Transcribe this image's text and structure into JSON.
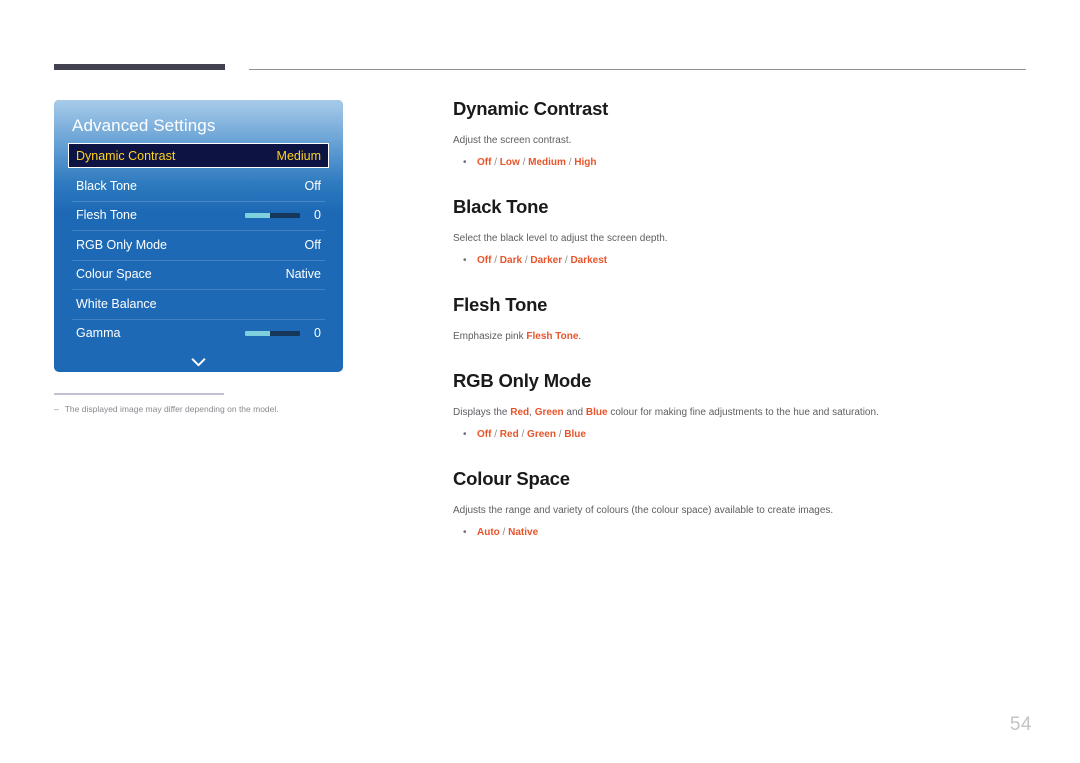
{
  "page_number": "54",
  "osd": {
    "title": "Advanced Settings",
    "rows": [
      {
        "label": "Dynamic Contrast",
        "value": "Medium",
        "type": "value",
        "selected": true
      },
      {
        "label": "Black Tone",
        "value": "Off",
        "type": "value",
        "selected": false
      },
      {
        "label": "Flesh Tone",
        "value": "0",
        "type": "slider",
        "selected": false
      },
      {
        "label": "RGB Only Mode",
        "value": "Off",
        "type": "value",
        "selected": false
      },
      {
        "label": "Colour Space",
        "value": "Native",
        "type": "value",
        "selected": false
      },
      {
        "label": "White Balance",
        "value": "",
        "type": "none",
        "selected": false
      },
      {
        "label": "Gamma",
        "value": "0",
        "type": "slider",
        "selected": false
      }
    ],
    "more_icon": "chevron-down-icon",
    "colors": {
      "panel_blue": "#1d69b5",
      "selected_bg": "#0d1444",
      "selected_text": "#ffd21e",
      "slider_fill": "#7fd0dd",
      "slider_track": "#17365c"
    }
  },
  "note": {
    "dash": "‒",
    "text": "The displayed image may differ depending on the model."
  },
  "doc": {
    "sections": [
      {
        "heading": "Dynamic Contrast",
        "desc_before": "Adjust the screen contrast.",
        "bullet": "•",
        "options": "Off / Low / Medium / High"
      },
      {
        "heading": "Black Tone",
        "desc_before": "Select the black level to adjust the screen depth.",
        "bullet": "•",
        "options": "Off / Dark / Darker / Darkest"
      },
      {
        "heading": "Flesh Tone",
        "desc_before": "Emphasize pink ",
        "desc_em": "Flesh Tone",
        "desc_after": ".",
        "options": ""
      },
      {
        "heading": "RGB Only Mode",
        "desc_before": "Displays the ",
        "desc_em1": "Red",
        "desc_mid1": ", ",
        "desc_em2": "Green",
        "desc_mid2": " and ",
        "desc_em3": "Blue",
        "desc_after": " colour for making fine adjustments to the hue and saturation.",
        "bullet": "•",
        "options": "Off / Red / Green / Blue"
      },
      {
        "heading": "Colour Space",
        "desc_before": "Adjusts the range and variety of colours (the colour space) available to create images.",
        "bullet": "•",
        "options": "Auto / Native"
      }
    ],
    "accent_color": "#e8542a"
  }
}
